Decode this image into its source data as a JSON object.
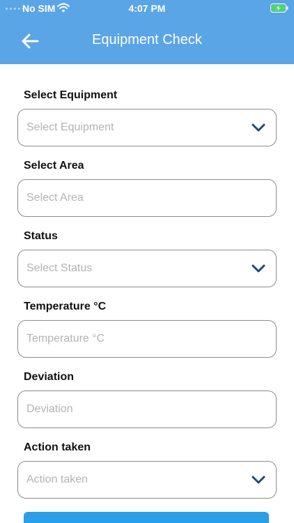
{
  "status_bar": {
    "carrier": "No SIM",
    "time": "4:07 PM"
  },
  "nav": {
    "title": "Equipment Check",
    "back_icon": "arrow-left-icon"
  },
  "form": {
    "fields": [
      {
        "label": "Select Equipment",
        "placeholder": "Select Equipment",
        "type": "select"
      },
      {
        "label": "Select Area",
        "placeholder": "Select Area",
        "type": "input"
      },
      {
        "label": "Status",
        "placeholder": "Select Status",
        "type": "select"
      },
      {
        "label": "Temperature °C",
        "placeholder": "Temperature °C",
        "type": "input"
      },
      {
        "label": "Deviation",
        "placeholder": "Deviation",
        "type": "input"
      },
      {
        "label": "Action taken",
        "placeholder": "Action taken",
        "type": "select"
      }
    ]
  },
  "colors": {
    "header_bg": "#5aa5e6",
    "chevron": "#1e4a70",
    "placeholder": "#b3b3b3",
    "border": "#8c8c8c",
    "button_bg": "#2a9ee6"
  }
}
